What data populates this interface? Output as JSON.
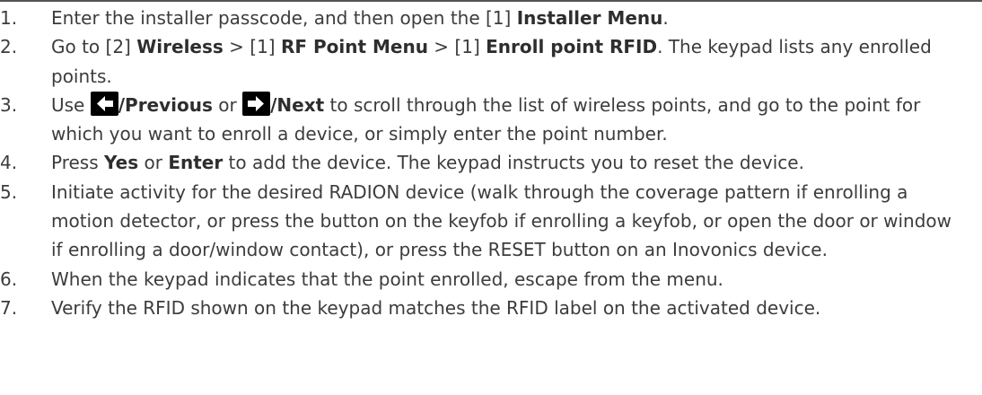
{
  "steps": [
    {
      "number": "1.",
      "parts": [
        "Enter the installer passcode, and then open the [1] ",
        "Installer Menu",
        "."
      ]
    },
    {
      "number": "2.",
      "parts": [
        "Go to [2] ",
        "Wireless",
        " > [1] ",
        "RF Point Menu",
        " > [1] ",
        "Enroll point RFID",
        ". The keypad lists any enrolled points."
      ]
    },
    {
      "number": "3.",
      "parts": [
        "Use ",
        "/Previous",
        " or ",
        "/Next",
        " to scroll through the list of wireless points, and go to the point for which you want to enroll a device, or simply enter the point number."
      ],
      "icons": [
        "left-arrow-key-icon",
        "right-arrow-key-icon"
      ]
    },
    {
      "number": "4.",
      "parts": [
        "Press ",
        "Yes",
        " or ",
        "Enter",
        " to add the device. The keypad instructs you to reset the device."
      ]
    },
    {
      "number": "5.",
      "parts": [
        "Initiate activity for the desired RADION device (walk through the coverage pattern if enrolling a motion detector, or press the button on the keyfob if enrolling a keyfob, or open the door or window if enrolling a door/window contact), or press the RESET button on an Inovonics device."
      ]
    },
    {
      "number": "6.",
      "parts": [
        "When the keypad indicates that the point enrolled, escape from the menu."
      ]
    },
    {
      "number": "7.",
      "parts": [
        "Verify the RFID shown on the keypad matches the RFID label on the activated device."
      ]
    }
  ]
}
